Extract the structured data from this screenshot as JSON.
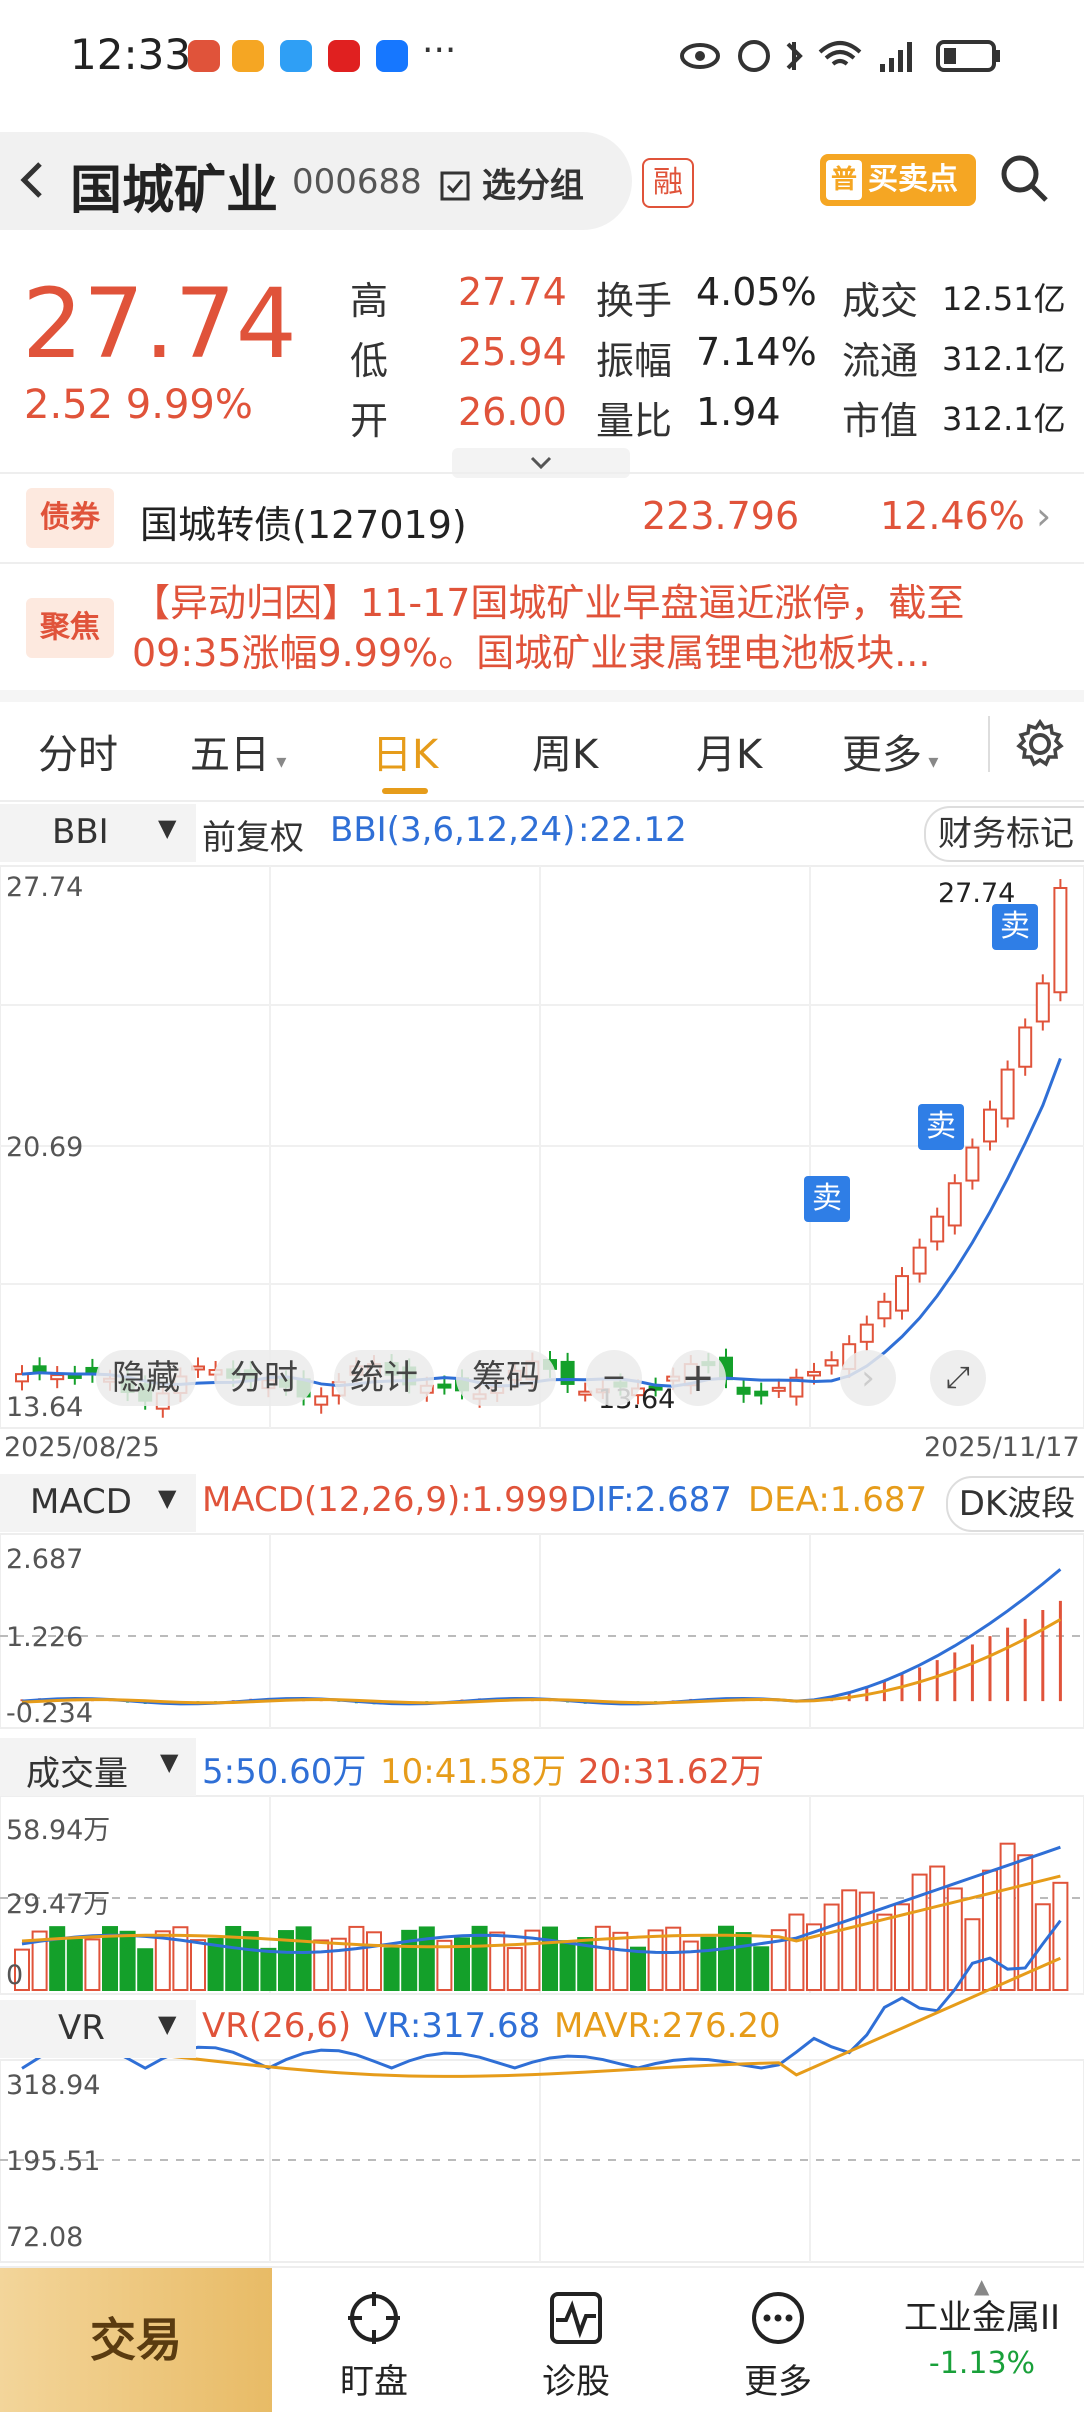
{
  "status_bar": {
    "time": "12:33"
  },
  "header": {
    "back_icon": "chevron-left-icon",
    "stock_name": "国城矿业",
    "stock_code": "000688",
    "add_group_label": "选分组",
    "margin_tag": "融",
    "buy_sell_badge": "普",
    "buy_sell_label": "买卖点",
    "search_icon": "search-icon"
  },
  "quote": {
    "price": "27.74",
    "change": "2.52 9.99%",
    "stats": [
      {
        "label": "高",
        "value": "27.74",
        "color": "red"
      },
      {
        "label": "换手",
        "value": "4.05%",
        "color": "dark"
      },
      {
        "label": "成交",
        "value": "12.51亿",
        "color": "dark"
      },
      {
        "label": "低",
        "value": "25.94",
        "color": "red"
      },
      {
        "label": "振幅",
        "value": "7.14%",
        "color": "dark"
      },
      {
        "label": "流通",
        "value": "312.1亿",
        "color": "dark"
      },
      {
        "label": "开",
        "value": "26.00",
        "color": "red"
      },
      {
        "label": "量比",
        "value": "1.94",
        "color": "dark"
      },
      {
        "label": "市值",
        "value": "312.1亿",
        "color": "dark"
      }
    ]
  },
  "bond": {
    "tag": "债券",
    "name": "国城转债(127019)",
    "price": "223.796",
    "pct": "12.46%"
  },
  "news": {
    "tag": "聚焦",
    "text": "【异动归因】11-17国城矿业早盘逼近涨停，截至09:35涨幅9.99%。国城矿业隶属锂电池板块..."
  },
  "tabs": [
    {
      "label": "分时"
    },
    {
      "label": "五日"
    },
    {
      "label": "日K",
      "active": true
    },
    {
      "label": "周K"
    },
    {
      "label": "月K"
    },
    {
      "label": "更多"
    }
  ],
  "kline": {
    "selector": "BBI",
    "adjust": "前复权",
    "indicator": "BBI(3,6,12,24)",
    "indicator_value": ":22.12",
    "fin_marks": "财务标记",
    "y_top": "27.74",
    "y_mid": "20.69",
    "y_bottom": "13.64",
    "date_start": "2025/08/25",
    "date_end": "2025/11/17",
    "max_label": "27.74",
    "min_label": "13.64",
    "sell_mark": "卖",
    "overlay_buttons": [
      "隐藏",
      "分时",
      "统计",
      "筹码"
    ]
  },
  "macd": {
    "selector": "MACD",
    "title": "MACD(12,26,9):1.999",
    "dif": "DIF:2.687",
    "dea": "DEA:1.687",
    "extra_button": "DK波段",
    "y_top": "2.687",
    "y_mid": "1.226",
    "y_bottom": "-0.234"
  },
  "volume": {
    "selector": "成交量",
    "ma5": "5:50.60万",
    "ma10": "10:41.58万",
    "ma20": "20:31.62万",
    "y_top": "58.94万",
    "y_mid": "29.47万",
    "y_bottom": "0"
  },
  "vr": {
    "selector": "VR",
    "title": "VR(26,6)",
    "vr": "VR:317.68",
    "mavr": "MAVR:276.20",
    "y_top": "318.94",
    "y_mid": "195.51",
    "y_bottom": "72.08"
  },
  "bottom_nav": {
    "trade": "交易",
    "items": [
      {
        "label": "盯盘",
        "icon": "crosshair-icon"
      },
      {
        "label": "诊股",
        "icon": "pulse-icon"
      },
      {
        "label": "更多",
        "icon": "more-icon"
      }
    ],
    "sector_name": "工业金属II",
    "sector_pct": "-1.13%"
  },
  "colors": {
    "up": "#e0533a",
    "down": "#14a02a",
    "bbi": "#2f6fd6",
    "accent": "#e69c1a"
  }
}
